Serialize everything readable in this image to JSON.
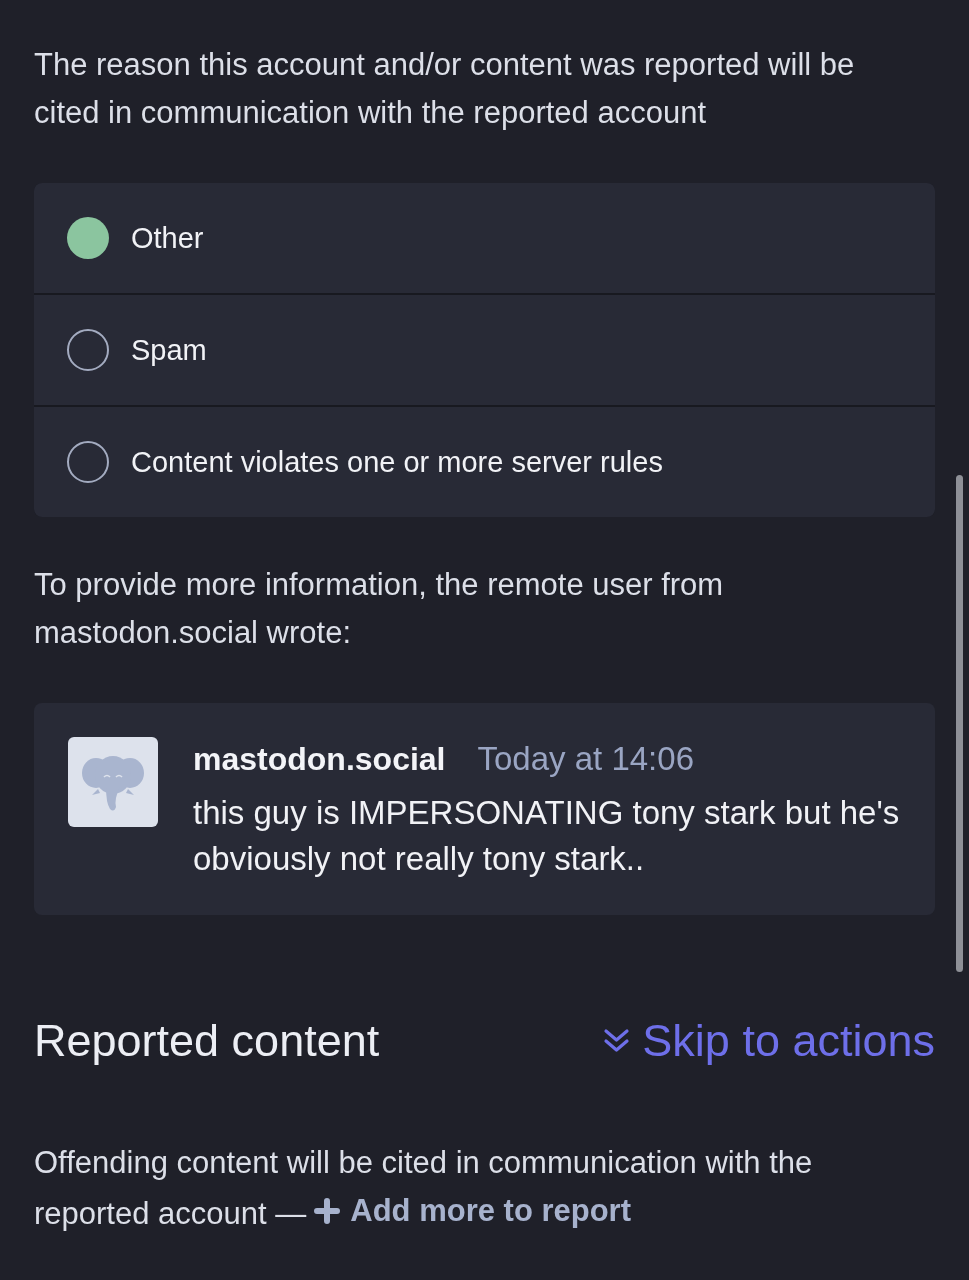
{
  "intro": "The reason this account and/or content was reported will be cited in communication with the reported account",
  "reasons": [
    {
      "label": "Other",
      "selected": true
    },
    {
      "label": "Spam",
      "selected": false
    },
    {
      "label": "Content violates one or more server rules",
      "selected": false
    }
  ],
  "remote_note": "To provide more information, the remote user from mastodon.social wrote:",
  "comment": {
    "author": "mastodon.social",
    "time": "Today at 14:06",
    "text": "this guy is IMPERSONATING tony stark but he's obviously not really tony stark.."
  },
  "section": {
    "title": "Reported content",
    "skip_link": "Skip to actions"
  },
  "footer": {
    "text": "Offending content will be cited in communication with the reported account —",
    "link": "Add more to report"
  }
}
